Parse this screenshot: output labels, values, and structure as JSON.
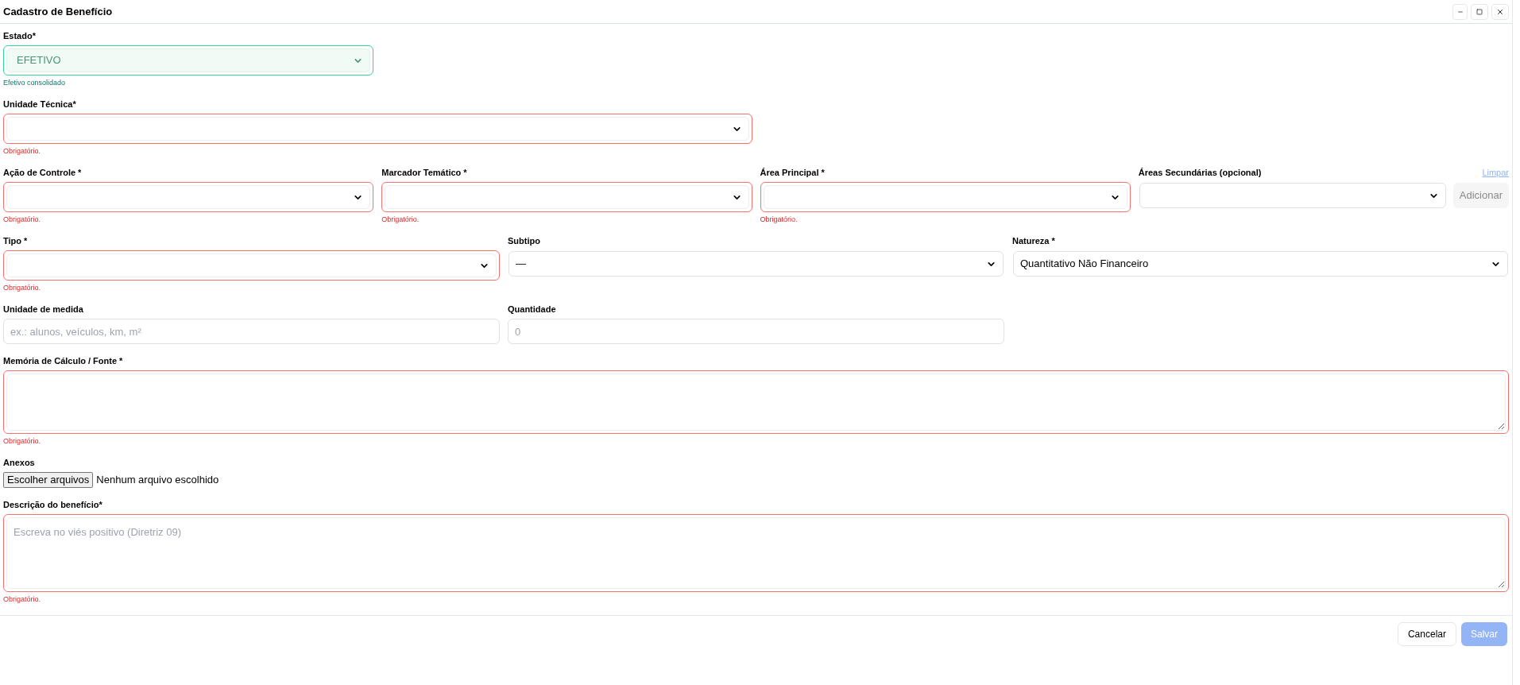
{
  "window": {
    "title": "Cadastro de Benefício"
  },
  "rows": [
    {
      "fields": [
        {
          "kind": "select",
          "label": "Estado*",
          "value": "EFETIVO",
          "valid": true,
          "invalid": false,
          "message": "Efetivo consolidado"
        }
      ]
    },
    {
      "fields": [
        {
          "kind": "select",
          "label": "Unidade Técnica*",
          "invalid": true,
          "message": "Obrigatório."
        }
      ]
    },
    {
      "fields": [
        {
          "kind": "select",
          "label": "Ação de Controle *",
          "invalid": true,
          "message": "Obrigatório."
        },
        {
          "kind": "select",
          "label": "Marcador Temático *",
          "invalid": true,
          "message": "Obrigatório."
        },
        {
          "kind": "select",
          "label": "Área Principal *",
          "invalid": true,
          "message": "Obrigatório."
        },
        {
          "kind": "select-add",
          "label": "Áreas Secundárias (opcional)",
          "invalid": false,
          "link": "Limpar",
          "button": {
            "label": "Adicionar",
            "disabled": true
          }
        }
      ]
    },
    {
      "fields": [
        {
          "kind": "select",
          "label": "Tipo *",
          "invalid": true,
          "message": "Obrigatório."
        },
        {
          "kind": "select",
          "label": "Subtipo",
          "value": "—",
          "invalid": false
        },
        {
          "kind": "select",
          "label": "Natureza *",
          "value": "Quantitativo Não Financeiro",
          "invalid": false
        }
      ]
    },
    {
      "fields": [
        {
          "kind": "input",
          "label": "Unidade de medida",
          "placeholder": "ex.: alunos, veículos, km, m²",
          "invalid": false
        },
        {
          "kind": "input",
          "label": "Quantidade",
          "placeholder": "0",
          "invalid": false
        }
      ]
    },
    {
      "fields": [
        {
          "kind": "textarea",
          "label": "Memória de Cálculo / Fonte *",
          "invalid": true,
          "message": "Obrigatório."
        }
      ]
    },
    {
      "fields": [
        {
          "kind": "file",
          "label": "Anexos",
          "button": {
            "label": "Escolher arquivos",
            "disabled": false
          },
          "file_status": "Nenhum arquivo escolhido"
        }
      ]
    },
    {
      "fields": [
        {
          "kind": "textarea",
          "label": "Descrição do benefício*",
          "placeholder": "Escreva no viés positivo (Diretriz 09)",
          "invalid": true,
          "message": "Obrigatório."
        }
      ]
    }
  ],
  "footer": {
    "buttons": [
      {
        "label": "Cancelar",
        "kind": "secondary",
        "disabled": false
      },
      {
        "label": "Salvar",
        "kind": "primary",
        "disabled": true
      }
    ]
  }
}
